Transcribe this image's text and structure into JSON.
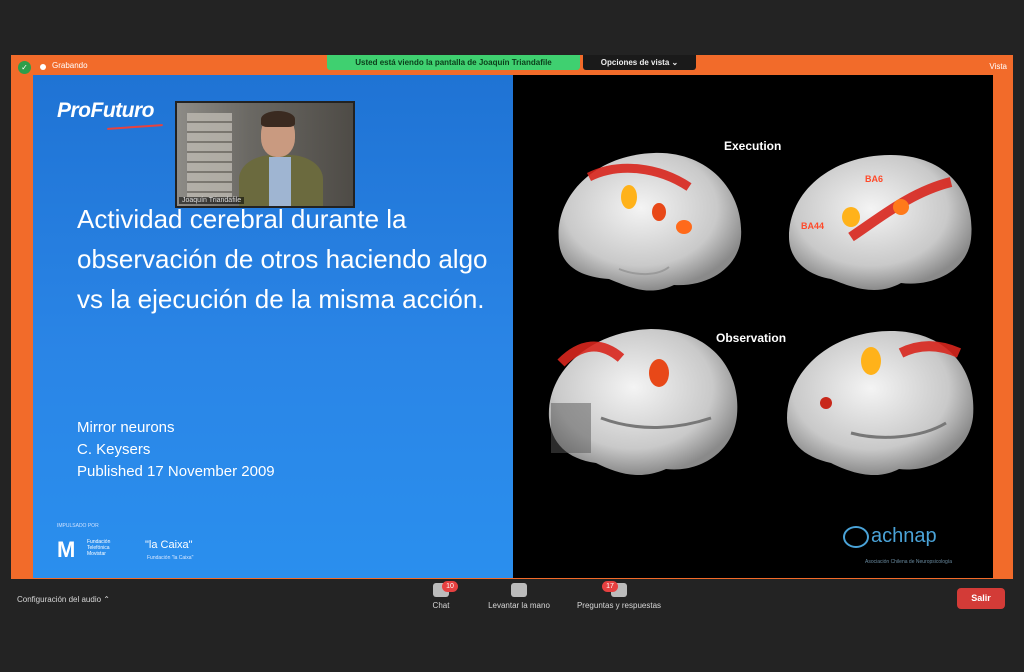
{
  "window": {
    "recording_label": "Grabando",
    "share_banner": "Usted está viendo la pantalla de Joaquín Triandafile",
    "view_options": "Opciones de vista ⌄",
    "view_button": "Vista"
  },
  "slide_left": {
    "logo": "ProFuturo",
    "webcam_name": "Joaquín Triandafile",
    "title": "Actividad cerebral durante la observación de otros haciendo algo vs la ejecución de la misma acción.",
    "meta": [
      "Mirror neurons",
      "C. Keysers",
      "Published 17 November 2009"
    ],
    "sponsor_label": "IMPULSADO POR",
    "sponsor_1": "M",
    "sponsor_1_sub": "Fundación Telefónica Movistar",
    "sponsor_2": "\"la Caixa\"",
    "sponsor_2_sub": "Fundación \"la Caixa\""
  },
  "slide_right": {
    "label_execution": "Execution",
    "label_observation": "Observation",
    "brain_labels": [
      "BA6",
      "BA44"
    ],
    "achnap": "achnap",
    "achnap_sub": "Asociación Chilena de Neuropsicología"
  },
  "bottom": {
    "audio_config": "Configuración del audio ⌃",
    "chat_label": "Chat",
    "chat_badge": "10",
    "raise_hand_label": "Levantar la mano",
    "qa_label": "Preguntas y respuestas",
    "qa_badge": "17",
    "leave_label": "Salir"
  },
  "colors": {
    "frame_orange": "#f26b2a",
    "slide_blue": "#1f73d4",
    "banner_green": "#3fd070",
    "leave_red": "#d33b37"
  }
}
